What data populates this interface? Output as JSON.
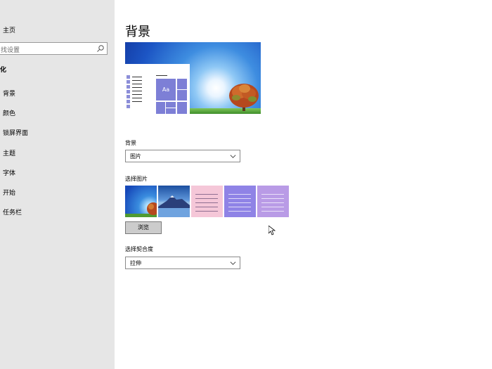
{
  "sidebar": {
    "home_label": "主页",
    "search_placeholder": "找设置",
    "section_heading": "化",
    "items": [
      {
        "label": "背景"
      },
      {
        "label": "颜色"
      },
      {
        "label": "锁屏界面"
      },
      {
        "label": "主题"
      },
      {
        "label": "字体"
      },
      {
        "label": "开始"
      },
      {
        "label": "任务栏"
      }
    ]
  },
  "main": {
    "title": "背景",
    "preview": {
      "tile_text": "Aa"
    },
    "background_label": "背景",
    "background_value": "图片",
    "choose_picture_label": "选择图片",
    "browse_label": "浏览",
    "fit_label": "选择契合度",
    "fit_value": "拉伸"
  },
  "colors": {
    "sidebar_bg": "#e6e6e6",
    "accent": "#7d7fd6"
  }
}
